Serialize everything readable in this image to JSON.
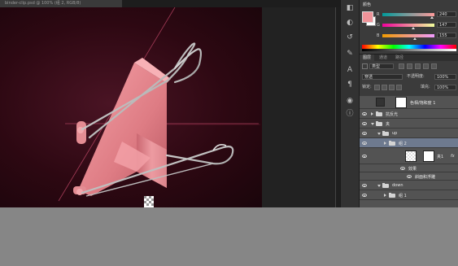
{
  "document": {
    "tab_title": "binder-clip.psd @ 100% (组 2, RGB/8)"
  },
  "color_panel": {
    "tab_label": "颜色",
    "channels": [
      {
        "label": "R",
        "value": "240",
        "fraction": 0.94,
        "gradient": [
          "#009b9b",
          "#ff9b9b"
        ]
      },
      {
        "label": "G",
        "value": "147",
        "fraction": 0.58,
        "gradient": [
          "#f0009b",
          "#f0ff9b"
        ]
      },
      {
        "label": "B",
        "value": "155",
        "fraction": 0.61,
        "gradient": [
          "#f09b00",
          "#f09bff"
        ]
      }
    ],
    "foreground_color": "#f09399",
    "background_color": "#ffffff"
  },
  "layers_panel": {
    "tabs": [
      "图层",
      "通道",
      "路径"
    ],
    "filter_kind": "类型",
    "blend_mode": "穿透",
    "opacity_label": "不透明度:",
    "opacity_value": "100%",
    "lock_label": "锁定:",
    "fill_label": "填充:",
    "fill_value": "100%",
    "layers": [
      {
        "name": "色相/饱和度 1",
        "type": "adjustment",
        "indent": 0,
        "selected": false
      },
      {
        "name": "抗反光",
        "type": "group",
        "indent": 0,
        "expanded": false,
        "selected": false
      },
      {
        "name": "夹",
        "type": "group",
        "indent": 0,
        "expanded": true,
        "selected": false
      },
      {
        "name": "up",
        "type": "group",
        "indent": 1,
        "expanded": true,
        "selected": false
      },
      {
        "name": "组 2",
        "type": "group",
        "indent": 2,
        "expanded": false,
        "selected": true
      },
      {
        "name": "夹1",
        "type": "layer",
        "indent": 2,
        "selected": false,
        "fx": "fx"
      },
      {
        "name": "效果",
        "type": "effects-header",
        "indent": 3,
        "selected": false
      },
      {
        "name": "斜面和浮雕",
        "type": "effect",
        "indent": 4,
        "selected": false
      },
      {
        "name": "down",
        "type": "group",
        "indent": 1,
        "expanded": true,
        "selected": false
      },
      {
        "name": "组 1",
        "type": "group",
        "indent": 2,
        "expanded": false,
        "selected": false
      }
    ]
  },
  "icons": [
    "color-panel-icon",
    "adjustments-icon",
    "history-icon",
    "character-icon",
    "paragraph-icon",
    "properties-icon",
    "info-icon",
    "brush-icon"
  ],
  "accent": "#6e7a8f"
}
